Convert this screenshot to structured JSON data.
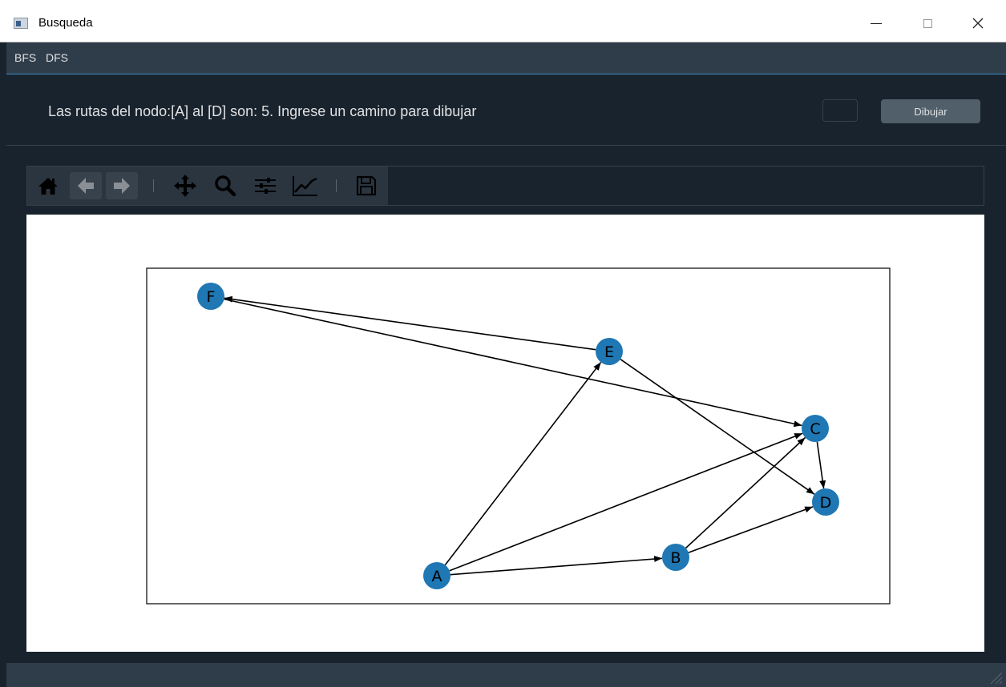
{
  "window": {
    "title": "Busqueda",
    "controls": {
      "minimize": "—",
      "maximize": "☐",
      "close": "✕"
    }
  },
  "menu": {
    "items": [
      "BFS",
      "DFS"
    ]
  },
  "header": {
    "info_text": "Las rutas del nodo:[A] al [D] son: 5. Ingrese un camino para dibujar",
    "path_input_value": "",
    "draw_button_label": "Dibujar"
  },
  "toolbar": {
    "buttons": [
      "home-icon",
      "back-icon",
      "forward-icon",
      "pan-icon",
      "zoom-icon",
      "configure-subplots-icon",
      "edit-axes-icon",
      "save-icon"
    ]
  },
  "graph": {
    "node_color": "#1f77b4",
    "nodes": [
      {
        "id": "F",
        "label": "F"
      },
      {
        "id": "E",
        "label": "E"
      },
      {
        "id": "C",
        "label": "C"
      },
      {
        "id": "D",
        "label": "D"
      },
      {
        "id": "B",
        "label": "B"
      },
      {
        "id": "A",
        "label": "A"
      }
    ],
    "edges": [
      [
        "A",
        "E"
      ],
      [
        "A",
        "C"
      ],
      [
        "A",
        "B"
      ],
      [
        "B",
        "C"
      ],
      [
        "B",
        "D"
      ],
      [
        "E",
        "F"
      ],
      [
        "E",
        "D"
      ],
      [
        "F",
        "C"
      ],
      [
        "C",
        "D"
      ]
    ]
  },
  "colors": {
    "window_bg": "#19232d",
    "menubar_bg": "#2f3d4b",
    "accent": "#3d8ec9",
    "button_bg": "#505f69",
    "text": "#e0e1e3"
  }
}
